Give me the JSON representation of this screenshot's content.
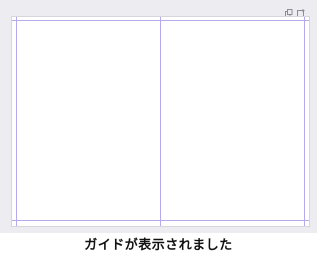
{
  "toolbar": {
    "icons": [
      "copy-page-icon",
      "add-page-icon"
    ]
  },
  "guides": {
    "visible": true,
    "color": "#b7a9ee"
  },
  "caption": {
    "text": "ガイドが表示されました"
  }
}
